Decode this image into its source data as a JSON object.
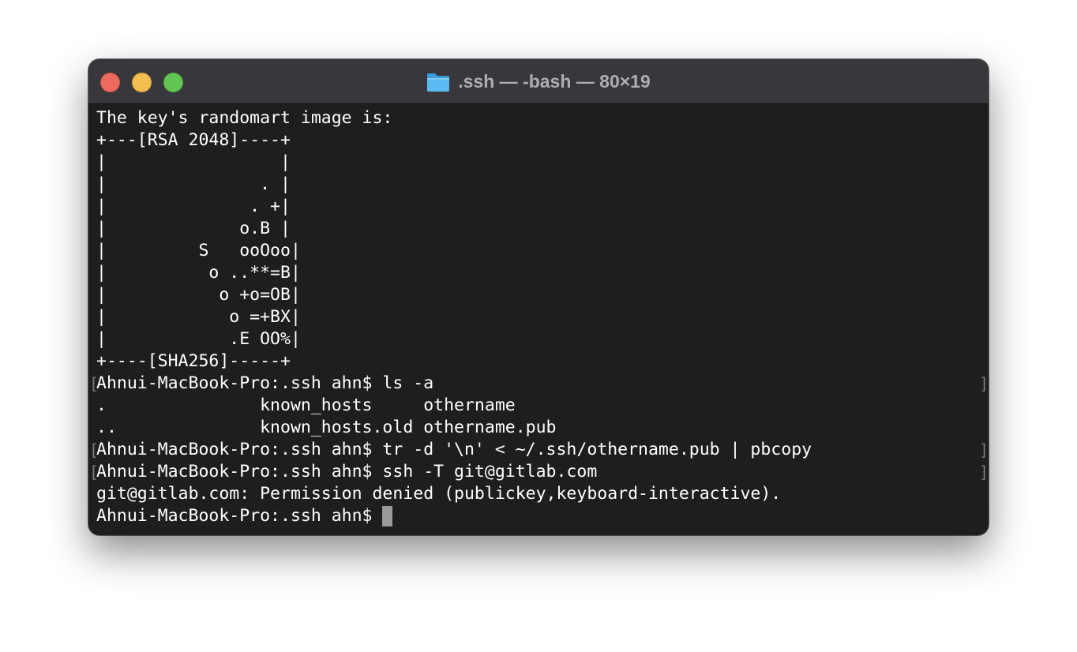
{
  "window": {
    "title": ".ssh — -bash — 80×19",
    "folder_icon": "folder-icon"
  },
  "terminal": {
    "lines": [
      "The key's randomart image is:",
      "+---[RSA 2048]----+",
      "|                 |",
      "|               . |",
      "|              . +|",
      "|             o.B |",
      "|         S   ooOoo|",
      "|          o ..**=B|",
      "|           o +o=OB|",
      "|            o =+BX|",
      "|            .E OO%|",
      "+----[SHA256]-----+",
      "Ahnui-MacBook-Pro:.ssh ahn$ ls -a",
      ".               known_hosts     othername",
      "..              known_hosts.old othername.pub",
      "Ahnui-MacBook-Pro:.ssh ahn$ tr -d '\\n' < ~/.ssh/othername.pub | pbcopy",
      "Ahnui-MacBook-Pro:.ssh ahn$ ssh -T git@gitlab.com",
      "git@gitlab.com: Permission denied (publickey,keyboard-interactive).",
      "Ahnui-MacBook-Pro:.ssh ahn$ "
    ],
    "mark_left": "[",
    "mark_right": "]"
  },
  "colors": {
    "background": "#1e1e1e",
    "titlebar": "#38373b",
    "text": "#ffffff",
    "close": "#ed6a5e",
    "minimize": "#f5bf4f",
    "zoom": "#61c554"
  }
}
